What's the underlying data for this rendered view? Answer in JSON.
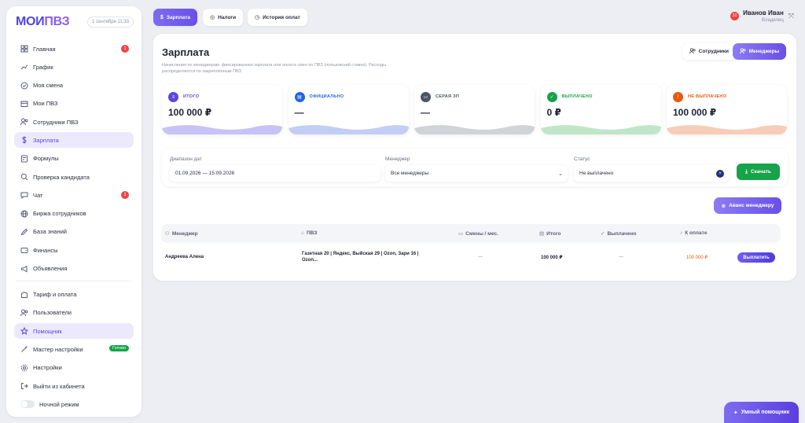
{
  "brand": {
    "logo_part1": "МОИ",
    "logo_part2": "ПВЗ",
    "date": "1 сентября 11:33"
  },
  "sidebar": {
    "items": [
      {
        "label": "Главная",
        "icon": "grid-icon",
        "badge": "1"
      },
      {
        "label": "График",
        "icon": "trend-icon"
      },
      {
        "label": "Моя смена",
        "icon": "check-circle-icon"
      },
      {
        "label": "Мои ПВЗ",
        "icon": "box-icon"
      },
      {
        "label": "Сотрудники ПВЗ",
        "icon": "users-icon"
      },
      {
        "label": "Зарплата",
        "icon": "dollar-icon",
        "active": true
      },
      {
        "label": "Формулы",
        "icon": "formula-icon"
      },
      {
        "label": "Проверка кандидата",
        "icon": "search-icon"
      },
      {
        "label": "Чат",
        "icon": "chat-icon",
        "badge": "1"
      },
      {
        "label": "Биржа сотрудников",
        "icon": "globe-icon"
      },
      {
        "label": "База знаний",
        "icon": "pen-icon"
      },
      {
        "label": "Финансы",
        "icon": "wallet-icon"
      },
      {
        "label": "Объявления",
        "icon": "megaphone-icon"
      }
    ],
    "items2": [
      {
        "label": "Тариф и оплата",
        "icon": "card-icon"
      },
      {
        "label": "Пользователи",
        "icon": "users-icon"
      },
      {
        "label": "Помощник",
        "icon": "star-icon",
        "active": true
      },
      {
        "label": "Мастер настройки",
        "icon": "wand-icon",
        "badge_green": "Готово"
      },
      {
        "label": "Настройки",
        "icon": "gear-icon"
      },
      {
        "label": "Выйти из кабинета",
        "icon": "logout-icon"
      }
    ],
    "night_mode": "Ночной режим"
  },
  "tabs": [
    {
      "label": "Зарплата",
      "icon": "$"
    },
    {
      "label": "Налоги",
      "icon": "◎"
    },
    {
      "label": "История оплат",
      "icon": "◷"
    }
  ],
  "user": {
    "name": "Иванов Иван",
    "role": "Владелец",
    "notifications": "31"
  },
  "page": {
    "title": "Зарплата",
    "description": "Начисления по менеджерам: фиксированная зарплата или оплата смен по ПВЗ (пользовский ставка). Расходы распределяются по закреплённым ПВЗ.",
    "btn_employees": "Сотрудники",
    "btn_managers": "Менеджеры"
  },
  "stats": [
    {
      "label": "ИТОГО",
      "value": "100 000 ₽",
      "color": "#5b47e0",
      "wave": "#c9c2f6"
    },
    {
      "label": "ОФИЦИАЛЬНО",
      "value": "—",
      "color": "#2563eb",
      "wave": "#c3cdf6"
    },
    {
      "label": "СЕРАЯ ЗП",
      "value": "—",
      "color": "#4b5563",
      "wave": "#d1d3d8"
    },
    {
      "label": "ВЫПЛАЧЕНО",
      "value": "0 ₽",
      "color": "#16a34a",
      "wave": "#bfe6c8"
    },
    {
      "label": "НЕ ВЫПЛАЧЕНО",
      "value": "100 000 ₽",
      "color": "#ea580c",
      "wave": "#f8cdb8"
    }
  ],
  "filters": {
    "range_label": "Диапазон дат",
    "range_value": "01.09.2026 — 15.09.2026",
    "manager_label": "Менеджер",
    "manager_value": "Все менеджеры",
    "status_label": "Статус",
    "status_value": "Не выплачено",
    "download": "Скачать"
  },
  "advance_button": "Аванс менеджеру",
  "table": {
    "headers": [
      "Менеджер",
      "ПВЗ",
      "Смены / мес.",
      "Итого",
      "Выплачено",
      "К оплате"
    ],
    "rows": [
      {
        "manager": "Андреева Алена",
        "pvz": "Газетная 20 | Яндекс, Выйская 29 | Ozon, Зари 16 | Ozon...",
        "shifts": "—",
        "total": "100 000 ₽",
        "paid": "—",
        "to_pay": "100 000 ₽",
        "action": "Выплатить"
      }
    ]
  },
  "assistant": "Умный помощник"
}
